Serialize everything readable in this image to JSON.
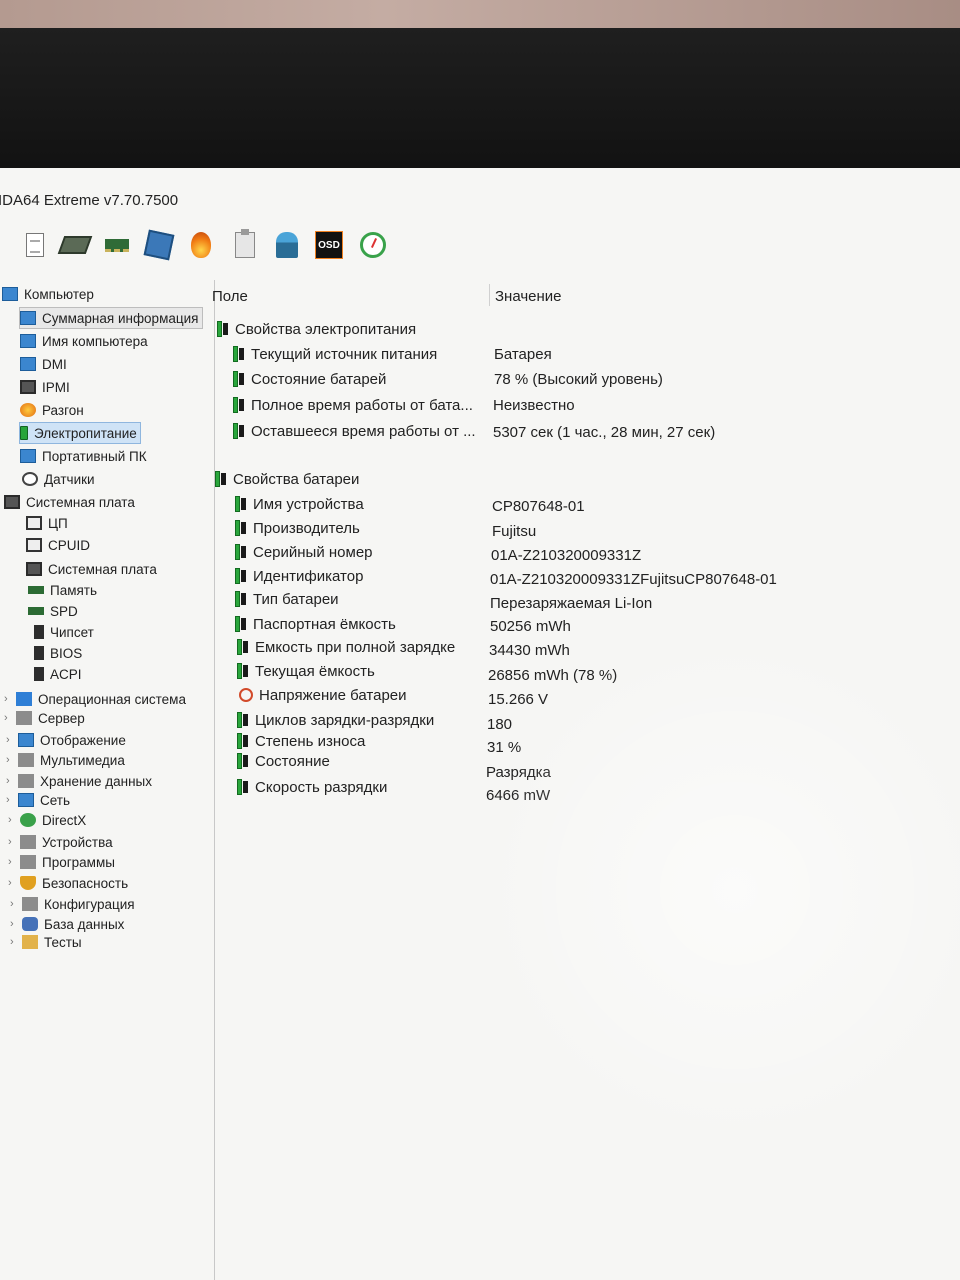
{
  "window": {
    "title": "IDA64 Extreme v7.70.7500"
  },
  "toolbar": {
    "buttons": [
      {
        "icon": "report-icon"
      },
      {
        "icon": "cpu-icon"
      },
      {
        "icon": "memory-icon"
      },
      {
        "icon": "motherboard-icon"
      },
      {
        "icon": "flame-icon"
      },
      {
        "icon": "clipboard-icon"
      },
      {
        "icon": "user-icon"
      },
      {
        "icon": "osd-icon",
        "label": "OSD"
      },
      {
        "icon": "gauge-icon"
      }
    ]
  },
  "tree": {
    "items": [
      {
        "label": "Компьютер",
        "icon": "computer-icon"
      },
      {
        "label": "Суммарная информация",
        "icon": "summary-icon"
      },
      {
        "label": "Имя компьютера",
        "icon": "computer-name-icon"
      },
      {
        "label": "DMI",
        "icon": "dmi-icon"
      },
      {
        "label": "IPMI",
        "icon": "ipmi-icon"
      },
      {
        "label": "Разгон",
        "icon": "overclock-icon"
      },
      {
        "label": "Электропитание",
        "icon": "power-icon"
      },
      {
        "label": "Портативный ПК",
        "icon": "laptop-icon"
      },
      {
        "label": "Датчики",
        "icon": "sensor-icon"
      },
      {
        "label": "Системная плата",
        "icon": "motherboard-icon"
      },
      {
        "label": "ЦП",
        "icon": "cpu-icon"
      },
      {
        "label": "CPUID",
        "icon": "cpuid-icon"
      },
      {
        "label": "Системная плата",
        "icon": "motherboard-icon"
      },
      {
        "label": "Память",
        "icon": "memory-icon"
      },
      {
        "label": "SPD",
        "icon": "spd-icon"
      },
      {
        "label": "Чипсет",
        "icon": "chipset-icon"
      },
      {
        "label": "BIOS",
        "icon": "bios-icon"
      },
      {
        "label": "ACPI",
        "icon": "acpi-icon"
      },
      {
        "label": "Операционная система",
        "icon": "windows-icon"
      },
      {
        "label": "Сервер",
        "icon": "server-icon"
      },
      {
        "label": "Отображение",
        "icon": "display-icon"
      },
      {
        "label": "Мультимедиа",
        "icon": "multimedia-icon"
      },
      {
        "label": "Хранение данных",
        "icon": "storage-icon"
      },
      {
        "label": "Сеть",
        "icon": "network-icon"
      },
      {
        "label": "DirectX",
        "icon": "directx-icon"
      },
      {
        "label": "Устройства",
        "icon": "devices-icon"
      },
      {
        "label": "Программы",
        "icon": "programs-icon"
      },
      {
        "label": "Безопасность",
        "icon": "security-icon"
      },
      {
        "label": "Конфигурация",
        "icon": "config-icon"
      },
      {
        "label": "База данных",
        "icon": "database-icon"
      },
      {
        "label": "Тесты",
        "icon": "tests-icon"
      }
    ]
  },
  "list": {
    "col_field": "Поле",
    "col_value": "Значение",
    "power_section": "Свойства электропитания",
    "power_rows": [
      {
        "field": "Текущий источник питания",
        "value": "Батарея"
      },
      {
        "field": "Состояние батарей",
        "value": "78 % (Высокий уровень)"
      },
      {
        "field": "Полное время работы от бата...",
        "value": "Неизвестно"
      },
      {
        "field": "Оставшееся время работы от ...",
        "value": "5307 сек (1 час., 28 мин, 27 сек)"
      }
    ],
    "battery_section": "Свойства батареи",
    "battery_rows": [
      {
        "field": "Имя устройства",
        "value": "CP807648-01"
      },
      {
        "field": "Производитель",
        "value": "Fujitsu"
      },
      {
        "field": "Серийный номер",
        "value": "01A-Z210320009331Z"
      },
      {
        "field": "Идентификатор",
        "value": "01A-Z210320009331ZFujitsuCP807648-01"
      },
      {
        "field": "Тип батареи",
        "value": "Перезаряжаемая Li-Ion"
      },
      {
        "field": "Паспортная ёмкость",
        "value": "50256 mWh"
      },
      {
        "field": "Емкость при полной зарядке",
        "value": "34430 mWh"
      },
      {
        "field": "Текущая ёмкость",
        "value": "26856 mWh  (78 %)"
      },
      {
        "field": "Напряжение батареи",
        "value": "15.266 V"
      },
      {
        "field": "Циклов зарядки-разрядки",
        "value": "180"
      },
      {
        "field": "Степень износа",
        "value": "31 %"
      },
      {
        "field": "Состояние",
        "value": "Разрядка"
      },
      {
        "field": "Скорость разрядки",
        "value": "6466 mW"
      }
    ]
  }
}
